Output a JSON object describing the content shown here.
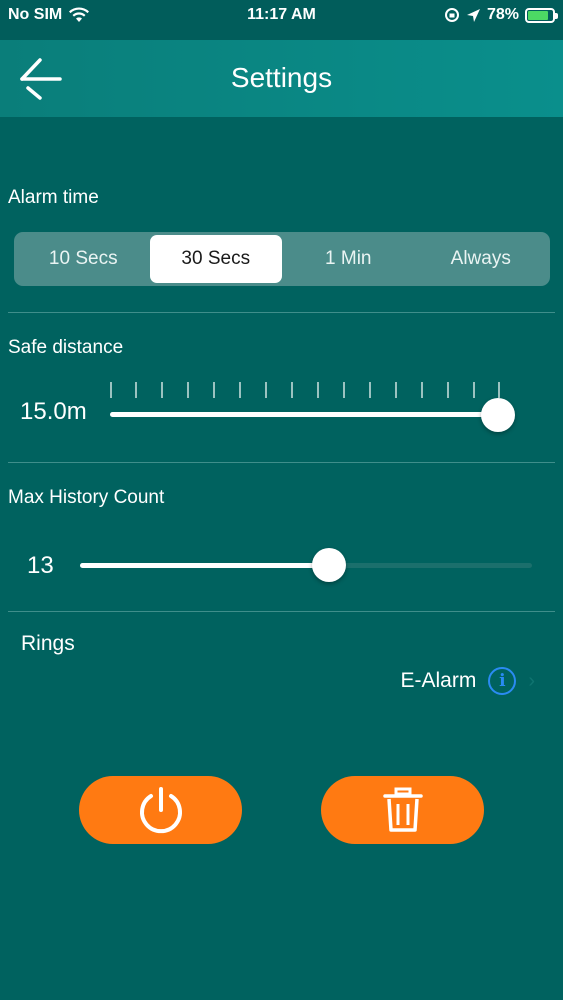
{
  "status_bar": {
    "carrier": "No SIM",
    "time": "11:17 AM",
    "battery_percent": "78%",
    "battery_level": 0.78
  },
  "header": {
    "title": "Settings"
  },
  "alarm_time": {
    "label": "Alarm time",
    "options": [
      "10 Secs",
      "30 Secs",
      "1 Min",
      "Always"
    ],
    "selected": "30 Secs"
  },
  "safe_distance": {
    "label": "Safe distance",
    "value": "15.0m",
    "level": 1.0
  },
  "max_history": {
    "label": "Max History Count",
    "value": "13",
    "level": 0.55
  },
  "rings": {
    "label": "Rings",
    "selected": "E-Alarm"
  },
  "colors": {
    "background": "#00625f",
    "header": "#0a8a86",
    "accent": "#ff7a12",
    "info": "#2a8bf2"
  },
  "icons": {
    "back": "arrow-left-icon",
    "power": "power-icon",
    "delete": "trash-icon",
    "info": "info-icon"
  }
}
